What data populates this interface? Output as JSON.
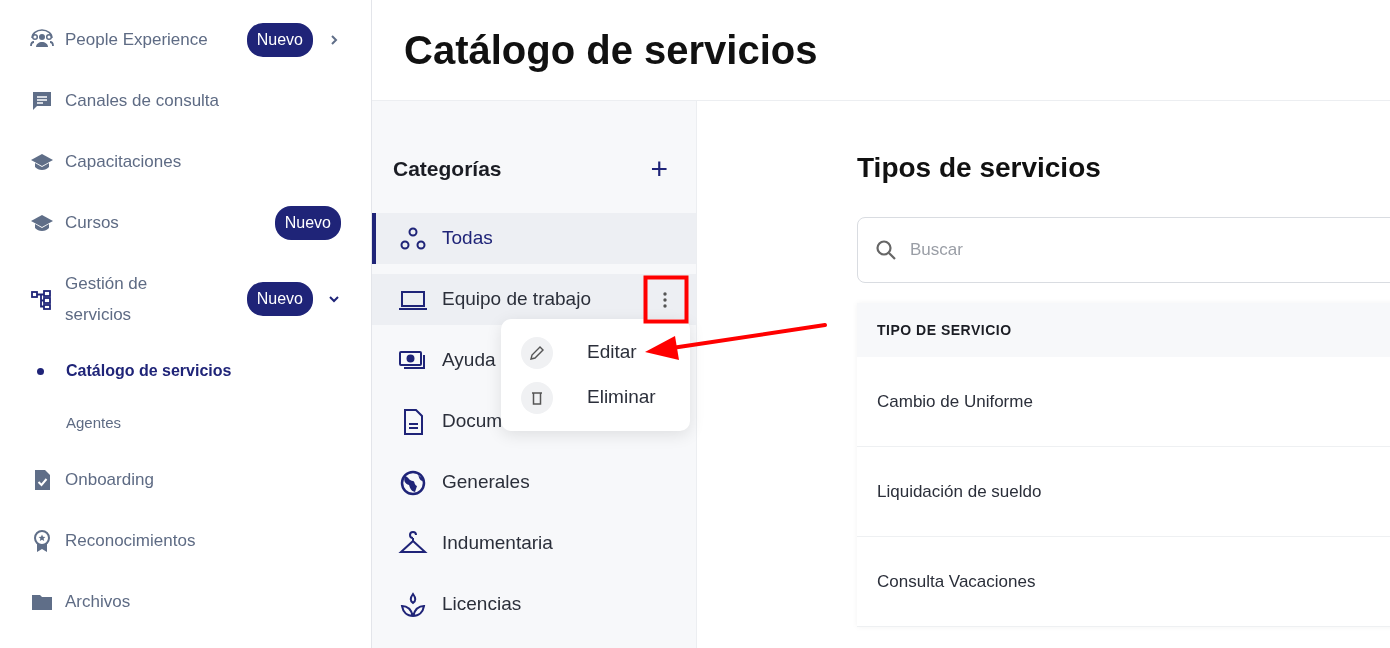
{
  "sidebar": {
    "items": [
      {
        "label": "People Experience",
        "badge": "Nuevo",
        "expanded": false
      },
      {
        "label": "Canales de consulta"
      },
      {
        "label": "Capacitaciones"
      },
      {
        "label": "Cursos",
        "badge": "Nuevo"
      },
      {
        "label": "Gestión de servicios",
        "badge": "Nuevo",
        "expanded": true,
        "children": [
          {
            "label": "Catálogo de servicios",
            "selected": true
          },
          {
            "label": "Agentes",
            "selected": false
          }
        ]
      },
      {
        "label": "Onboarding"
      },
      {
        "label": "Reconocimientos"
      },
      {
        "label": "Archivos"
      }
    ]
  },
  "page": {
    "title": "Catálogo de servicios"
  },
  "categories": {
    "title": "Categorías",
    "add": "+",
    "items": [
      {
        "label": "Todas",
        "selected": true,
        "menu_open": false
      },
      {
        "label": "Equipo de trabajo",
        "selected": false,
        "menu_open": true
      },
      {
        "label": "Ayuda",
        "selected": false,
        "menu_open": false
      },
      {
        "label": "Docum",
        "selected": false,
        "menu_open": false
      },
      {
        "label": "Generales",
        "selected": false,
        "menu_open": false
      },
      {
        "label": "Indumentaria",
        "selected": false,
        "menu_open": false
      },
      {
        "label": "Licencias",
        "selected": false,
        "menu_open": false
      }
    ],
    "menu": {
      "items": [
        {
          "label": "Editar"
        },
        {
          "label": "Eliminar"
        }
      ]
    }
  },
  "services": {
    "title": "Tipos de servicios",
    "search": {
      "placeholder": "Buscar"
    },
    "table": {
      "columns": [
        "TIPO DE SERVICIO"
      ],
      "rows": [
        [
          "Cambio de Uniforme"
        ],
        [
          "Liquidación de sueldo"
        ],
        [
          "Consulta Vacaciones"
        ]
      ]
    }
  }
}
